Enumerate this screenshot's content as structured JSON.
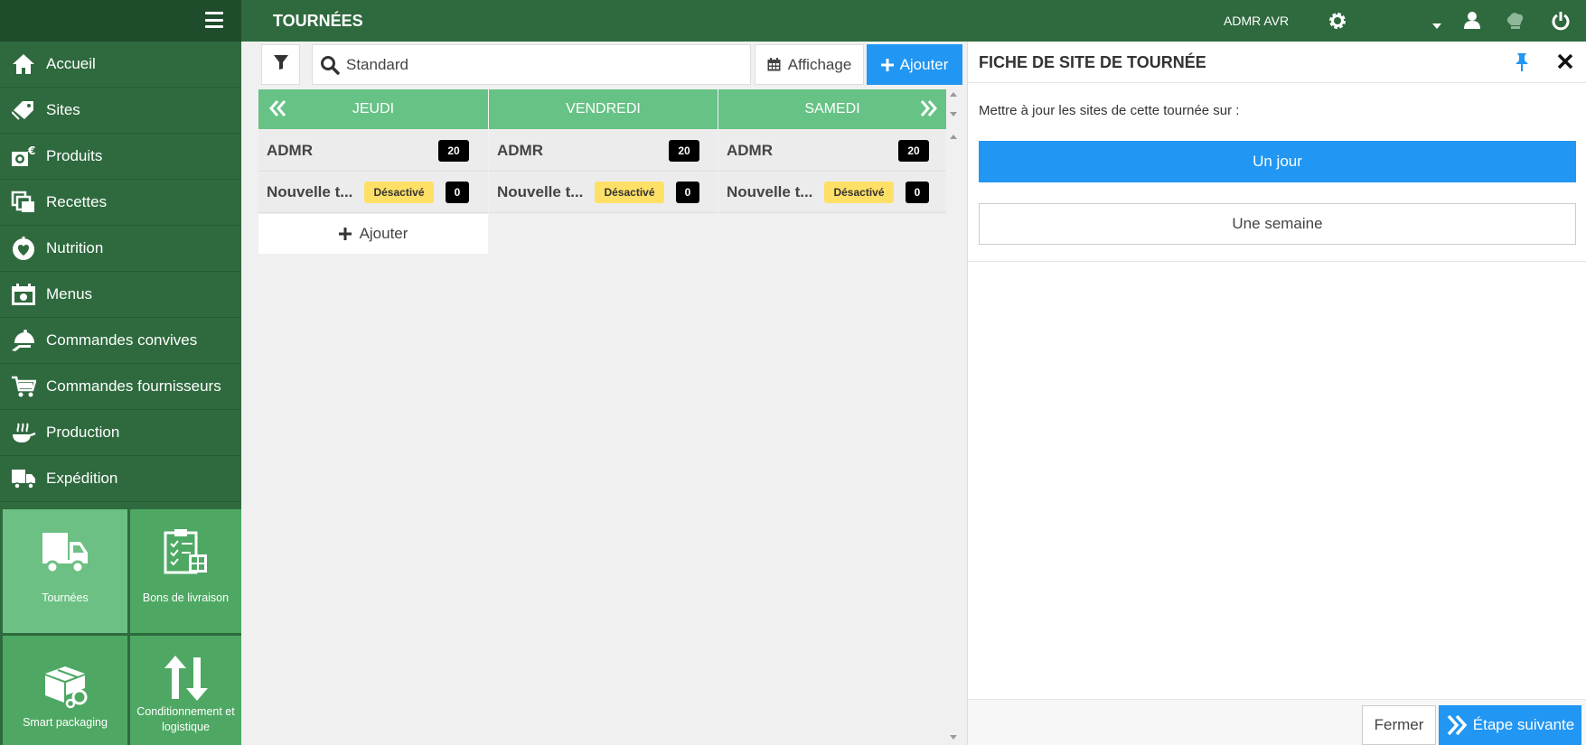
{
  "topbar": {
    "title": "TOURNÉES",
    "user": "ADMR AVR"
  },
  "sidebar": {
    "items": [
      {
        "label": "Accueil",
        "icon": "home-icon"
      },
      {
        "label": "Sites",
        "icon": "tag-icon"
      },
      {
        "label": "Produits",
        "icon": "product-icon"
      },
      {
        "label": "Recettes",
        "icon": "recipes-icon"
      },
      {
        "label": "Nutrition",
        "icon": "nutrition-icon"
      },
      {
        "label": "Menus",
        "icon": "calendar-icon"
      },
      {
        "label": "Commandes convives",
        "icon": "cloche-icon"
      },
      {
        "label": "Commandes fournisseurs",
        "icon": "cart-icon"
      },
      {
        "label": "Production",
        "icon": "cooking-icon"
      },
      {
        "label": "Expédition",
        "icon": "truck-icon"
      }
    ],
    "tiles": [
      {
        "label": "Tournées",
        "icon": "truck-icon"
      },
      {
        "label": "Bons de livraison",
        "icon": "delivery-note-icon"
      },
      {
        "label": "Smart packaging",
        "icon": "packaging-icon"
      },
      {
        "label": "Conditionnement et logistique",
        "icon": "arrows-updown-icon"
      }
    ]
  },
  "toolbar": {
    "search_value": "Standard",
    "display_label": "Affichage",
    "add_label": "Ajouter"
  },
  "days": [
    {
      "name": "JEUDI",
      "rows": [
        {
          "name": "ADMR",
          "count": "20"
        },
        {
          "name": "Nouvelle t...",
          "status": "Désactivé",
          "count": "0"
        }
      ]
    },
    {
      "name": "VENDREDI",
      "rows": [
        {
          "name": "ADMR",
          "count": "20"
        },
        {
          "name": "Nouvelle t...",
          "status": "Désactivé",
          "count": "0"
        }
      ]
    },
    {
      "name": "SAMEDI",
      "rows": [
        {
          "name": "ADMR",
          "count": "20"
        },
        {
          "name": "Nouvelle t...",
          "status": "Désactivé",
          "count": "0"
        }
      ]
    }
  ],
  "add_row_label": "Ajouter",
  "panel": {
    "title": "FICHE DE SITE DE TOURNÉE",
    "prompt": "Mettre à jour les sites de cette tournée sur :",
    "option_day": "Un jour",
    "option_week": "Une semaine",
    "close_label": "Fermer",
    "next_label": "Étape suivante"
  },
  "colors": {
    "sidebar": "#2e6a3e",
    "tile": "#4ea863",
    "tile_active": "#6cc083",
    "day_header": "#66c285",
    "primary": "#2196f3",
    "badge_status": "#ffe066"
  }
}
